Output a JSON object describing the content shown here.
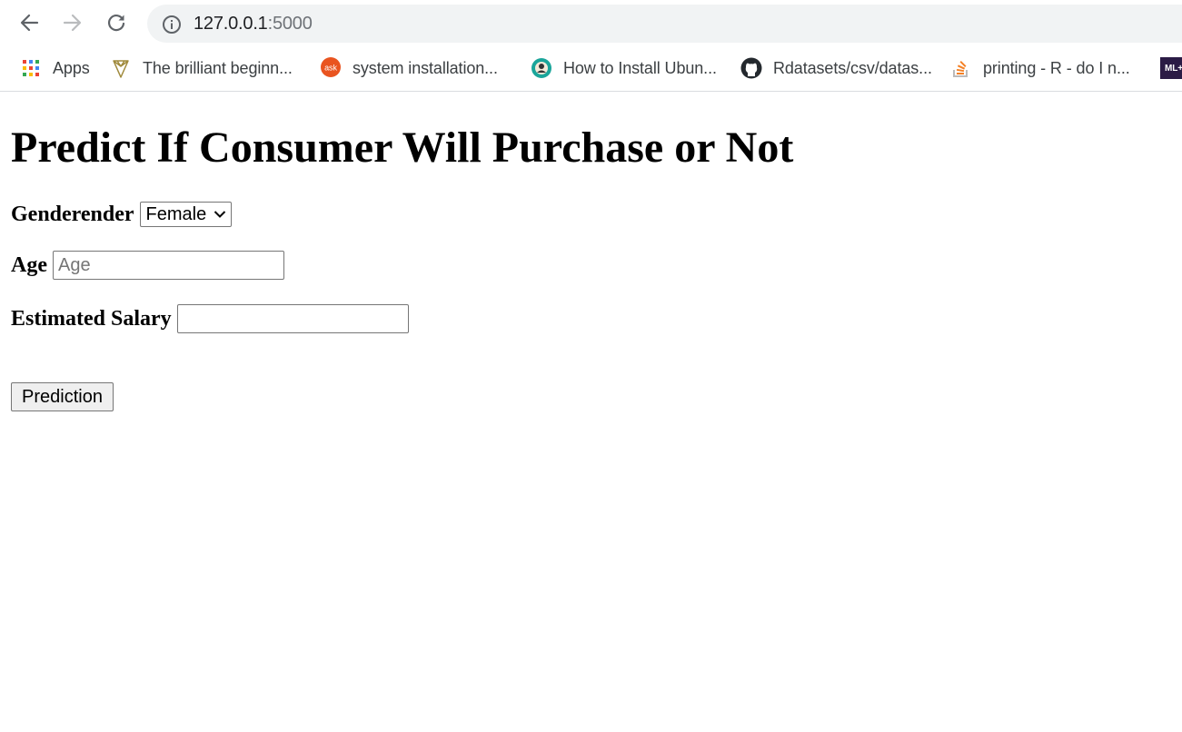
{
  "browser": {
    "url_host": "127.0.0.1",
    "url_port": ":5000",
    "bookmarks": [
      {
        "label": "Apps",
        "icon": "apps-grid-icon"
      },
      {
        "label": "The brilliant beginn...",
        "icon": "diamond-logo-icon"
      },
      {
        "label": "system installation...",
        "icon": "askubuntu-icon"
      },
      {
        "label": "How to Install Ubun...",
        "icon": "gear-avatar-icon"
      },
      {
        "label": "Rdatasets/csv/datas...",
        "icon": "github-icon"
      },
      {
        "label": "printing - R - do I n...",
        "icon": "stackoverflow-icon"
      },
      {
        "label": "ML+",
        "icon": "ml-plus-icon"
      }
    ]
  },
  "page": {
    "title": "Predict If Consumer Will Purchase or Not",
    "gender_label": "Genderender",
    "gender_selected": "Female",
    "age_label": "Age",
    "age_placeholder": "Age",
    "salary_label": "Estimated Salary",
    "salary_value": "",
    "submit_label": "Prediction"
  }
}
